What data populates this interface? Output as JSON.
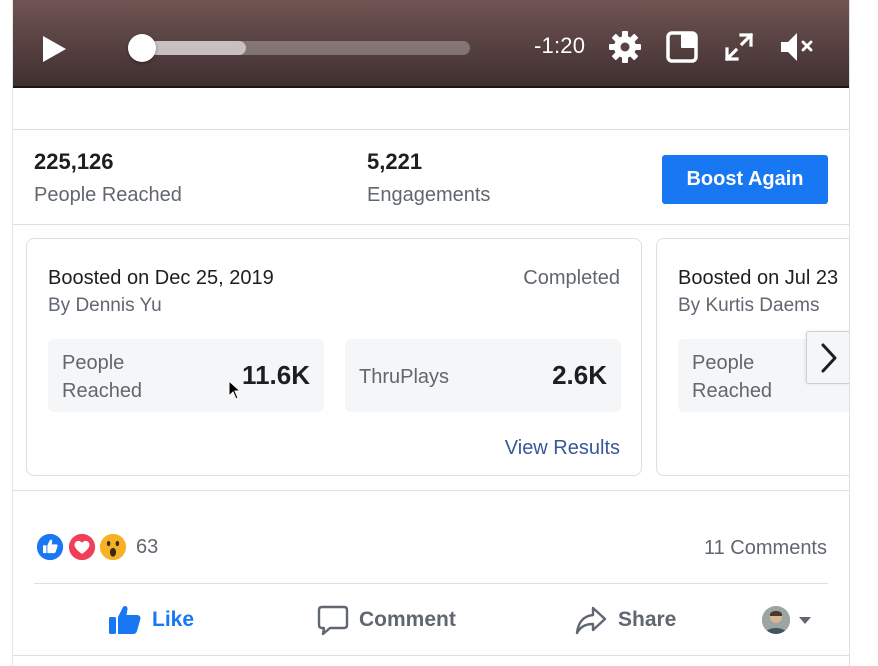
{
  "player": {
    "time_remaining": "-1:20",
    "progress": 0.0,
    "buffered": 0.32
  },
  "stats": {
    "reached_value": "225,126",
    "reached_label": "People Reached",
    "engagements_value": "5,221",
    "engagements_label": "Engagements",
    "boost_again_label": "Boost Again"
  },
  "cards": [
    {
      "title": "Boosted on Dec 25, 2019",
      "by": "By Dennis Yu",
      "status": "Completed",
      "metric1_label_line1": "People",
      "metric1_label_line2": "Reached",
      "metric1_value": "11.6K",
      "metric2_label": "ThruPlays",
      "metric2_value": "2.6K",
      "link": "View Results"
    },
    {
      "title": "Boosted on Jul 23",
      "by": "By Kurtis Daems",
      "metric1_label_line1": "People",
      "metric1_label_line2": "Reached"
    }
  ],
  "reactions": {
    "count": "63",
    "comments": "11 Comments",
    "icons": [
      "like-icon",
      "love-icon",
      "wow-icon"
    ]
  },
  "actions": {
    "like": "Like",
    "comment": "Comment",
    "share": "Share"
  },
  "colors": {
    "brand_blue": "#1877f2",
    "link_blue": "#385898",
    "secondary_text": "#606770",
    "love_red": "#f33e58",
    "wow_yellow": "#f7b125"
  }
}
